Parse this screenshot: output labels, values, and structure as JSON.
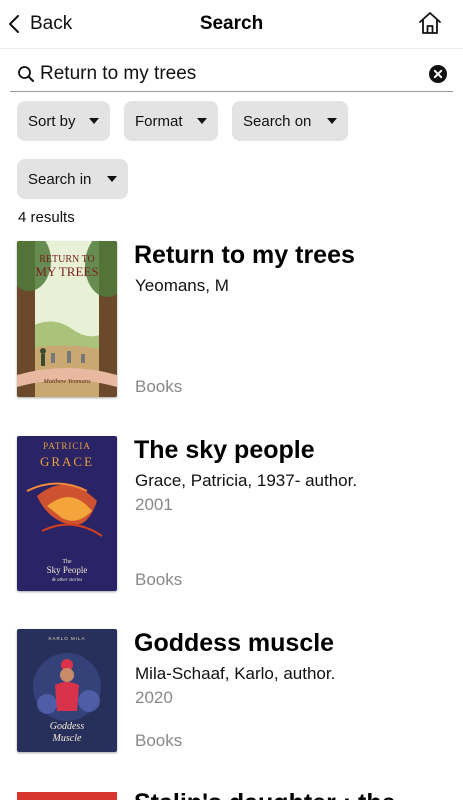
{
  "nav": {
    "back_label": "Back",
    "title": "Search"
  },
  "search": {
    "value": "Return to my trees"
  },
  "filters": [
    {
      "label": "Sort by"
    },
    {
      "label": "Format"
    },
    {
      "label": "Search on"
    },
    {
      "label": "Search in"
    }
  ],
  "results_count": "4 results",
  "results": [
    {
      "title": "Return to my trees",
      "author": "Yeomans, M",
      "format": "Books",
      "cover": {
        "line1": "RETURN TO",
        "line2": "MY TREES",
        "author": "Matthew Yeomans",
        "sky_color": "#e8f1d6",
        "tree_color": "#6b4a2c"
      }
    },
    {
      "title": "The sky people",
      "author": "Grace, Patricia, 1937- author.",
      "year": "2001",
      "format": "Books",
      "cover": {
        "author_first": "PATRICIA",
        "author_last": "GRACE",
        "line1": "The",
        "line2": "Sky People",
        "subtitle": "& other stories",
        "bg_color": "#2a2466"
      }
    },
    {
      "title": "Goddess muscle",
      "author": "Mila-Schaaf, Karlo, author.",
      "year": "2020",
      "format": "Books",
      "cover": {
        "author": "KARLO MILA",
        "line1": "Goddess",
        "line2": "Muscle",
        "bg_color": "#27305a"
      }
    },
    {
      "title": "Stalin's daughter : the"
    }
  ]
}
